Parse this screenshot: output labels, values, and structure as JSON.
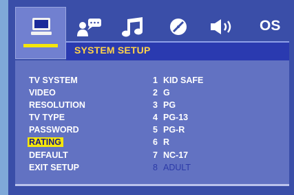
{
  "header": {
    "title": "SYSTEM SETUP",
    "tabs": [
      {
        "icon": "monitor-icon",
        "selected": true
      },
      {
        "icon": "speech-subtitle-icon",
        "selected": false
      },
      {
        "icon": "music-note-icon",
        "selected": false
      },
      {
        "icon": "disc-icon",
        "selected": false
      },
      {
        "icon": "speaker-icon",
        "selected": false
      },
      {
        "icon": "os-icon",
        "label": "OS",
        "selected": false
      }
    ]
  },
  "menu": {
    "items": [
      {
        "label": "TV SYSTEM"
      },
      {
        "label": "VIDEO"
      },
      {
        "label": "RESOLUTION"
      },
      {
        "label": "TV TYPE"
      },
      {
        "label": "PASSWORD"
      },
      {
        "label": "RATING",
        "selected": true
      },
      {
        "label": "DEFAULT"
      },
      {
        "label": "EXIT SETUP"
      }
    ]
  },
  "options": {
    "items": [
      {
        "num": "1",
        "label": "KID SAFE"
      },
      {
        "num": "2",
        "label": "G"
      },
      {
        "num": "3",
        "label": "PG"
      },
      {
        "num": "4",
        "label": "PG-13"
      },
      {
        "num": "5",
        "label": "PG-R"
      },
      {
        "num": "6",
        "label": "R"
      },
      {
        "num": "7",
        "label": "NC-17"
      },
      {
        "num": "8",
        "label": "ADULT",
        "dimmed": true
      }
    ]
  },
  "colors": {
    "background": "#3a4ea8",
    "panel": "#6272c2",
    "title_text": "#ffd24a",
    "highlight": "#f5e60a",
    "outer": "#7fa8d8"
  }
}
